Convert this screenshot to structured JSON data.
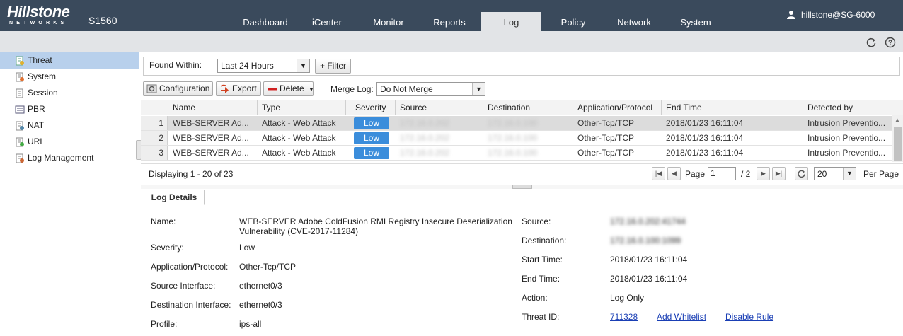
{
  "header": {
    "logo_text": "Hillstone",
    "logo_sub": "NETWORKS",
    "model": "S1560",
    "nav": [
      {
        "label": "Dashboard"
      },
      {
        "label": "iCenter"
      },
      {
        "label": "Monitor"
      },
      {
        "label": "Reports"
      },
      {
        "label": "Log"
      },
      {
        "label": "Policy"
      },
      {
        "label": "Network"
      },
      {
        "label": "System"
      }
    ],
    "active_nav": "Log",
    "user": "hillstone@SG-6000"
  },
  "toolbar_icons": [
    "refresh-icon",
    "help-icon"
  ],
  "sidebar": {
    "items": [
      {
        "label": "Threat",
        "icon": "threat-log-icon"
      },
      {
        "label": "System",
        "icon": "system-log-icon"
      },
      {
        "label": "Session",
        "icon": "session-log-icon"
      },
      {
        "label": "PBR",
        "icon": "pbr-log-icon"
      },
      {
        "label": "NAT",
        "icon": "nat-log-icon"
      },
      {
        "label": "URL",
        "icon": "url-log-icon"
      },
      {
        "label": "Log Management",
        "icon": "log-management-icon"
      }
    ],
    "active": "Threat"
  },
  "filter": {
    "found_within_label": "Found Within:",
    "found_within_value": "Last 24 Hours",
    "filter_button": "+ Filter"
  },
  "actions": {
    "configuration": "Configuration",
    "export": "Export",
    "delete": "Delete",
    "merge_label": "Merge Log:",
    "merge_value": "Do Not Merge"
  },
  "table": {
    "columns": [
      "Name",
      "Type",
      "Severity",
      "Source",
      "Destination",
      "Application/Protocol",
      "End Time",
      "Detected by"
    ],
    "rows": [
      {
        "num": "1",
        "name": "WEB-SERVER Ad...",
        "type": "Attack - Web Attack",
        "severity": "Low",
        "source": "172.16.0.202",
        "destination": "172.16.0.100",
        "app": "Other-Tcp/TCP",
        "end_time": "2018/01/23 16:11:04",
        "detected_by": "Intrusion Preventio..."
      },
      {
        "num": "2",
        "name": "WEB-SERVER Ad...",
        "type": "Attack - Web Attack",
        "severity": "Low",
        "source": "172.16.0.202",
        "destination": "172.16.0.100",
        "app": "Other-Tcp/TCP",
        "end_time": "2018/01/23 16:11:04",
        "detected_by": "Intrusion Preventio..."
      },
      {
        "num": "3",
        "name": "WEB-SERVER Ad...",
        "type": "Attack - Web Attack",
        "severity": "Low",
        "source": "172.16.0.202",
        "destination": "172.16.0.100",
        "app": "Other-Tcp/TCP",
        "end_time": "2018/01/23 16:11:04",
        "detected_by": "Intrusion Preventio..."
      }
    ],
    "severity_color": "#3b8ddb"
  },
  "pager": {
    "displaying": "Displaying 1 - 20 of 23",
    "page_label": "Page",
    "page_value": "1",
    "of_pages": "/ 2",
    "page_size": "20",
    "per_page": "Per Page"
  },
  "details": {
    "tab": "Log Details",
    "name_label": "Name:",
    "name_value_1": "WEB-SERVER Adobe ColdFusion RMI Registry Insecure Deserialization",
    "name_value_2": "Vulnerability (CVE-2017-11284)",
    "severity_label": "Severity:",
    "severity_value": "Low",
    "app_label": "Application/Protocol:",
    "app_value": "Other-Tcp/TCP",
    "src_if_label": "Source Interface:",
    "src_if_value": "ethernet0/3",
    "dst_if_label": "Destination Interface:",
    "dst_if_value": "ethernet0/3",
    "profile_label": "Profile:",
    "profile_value": "ips-all",
    "source_label": "Source:",
    "source_value": "172.16.0.202:41744",
    "destination_label": "Destination:",
    "destination_value": "172.16.0.100:1099",
    "start_label": "Start Time:",
    "start_value": "2018/01/23 16:11:04",
    "end_label": "End Time:",
    "end_value": "2018/01/23 16:11:04",
    "action_label": "Action:",
    "action_value": "Log Only",
    "threat_id_label": "Threat ID:",
    "threat_id_value": "711328",
    "add_whitelist": "Add Whitelist",
    "disable_rule": "Disable Rule"
  }
}
